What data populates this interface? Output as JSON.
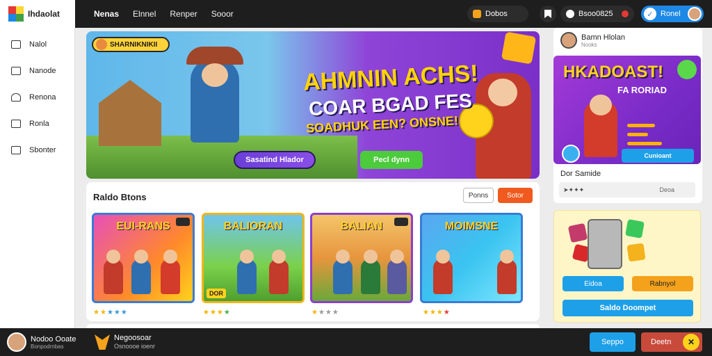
{
  "app": {
    "name": "Ihdaolat"
  },
  "nav": {
    "items": [
      "Nenas",
      "Elnnel",
      "Renper",
      "Sooor"
    ]
  },
  "header": {
    "coins_label": "Dobos",
    "time_label": "Bsoo0825",
    "user_label": "Ronel"
  },
  "sidebar": {
    "items": [
      {
        "label": "Nalol",
        "icon": "folder-icon"
      },
      {
        "label": "Nanode",
        "icon": "window-icon"
      },
      {
        "label": "Renona",
        "icon": "user-icon"
      },
      {
        "label": "Ronla",
        "icon": "list-icon"
      },
      {
        "label": "Sbonter",
        "icon": "chat-icon"
      }
    ]
  },
  "hero": {
    "badge": "SHARNIKNIKII",
    "line1": "AHMNIN ACHS!",
    "line2": "COAR BGAD FES",
    "line3": "SOADHUK EEN? ONSNE!",
    "button_primary": "Sasatind Hlador",
    "button_secondary": "Pecl dynn"
  },
  "games": {
    "title": "Raldo Btons",
    "btn_filter": "Ponns",
    "btn_sort": "Sotor",
    "cards": [
      {
        "title": "EUI-RANS",
        "badge": "",
        "rating": 4
      },
      {
        "title": "BALIORAN",
        "badge": "DOR",
        "rating": 4
      },
      {
        "title": "BALIAN",
        "badge": "",
        "rating": 1
      },
      {
        "title": "MOIMSNE",
        "badge": "",
        "rating": 3
      }
    ]
  },
  "right_panel": {
    "user_name": "Bamn Hlolan",
    "user_sub": "Nooks",
    "promo_title": "HKADOAST!",
    "promo_sub": "FA RORIAD",
    "promo_button": "Cunioant",
    "section_label": "Dor Samide",
    "row_value": "Deoa"
  },
  "rewards": {
    "button1": "Eidoa",
    "button2": "Rabnyol",
    "button3": "Saldo Doompet"
  },
  "footer": {
    "user_name": "Nodoo Ooate",
    "user_sub": "Bonpodrnbas",
    "title": "Negoosoar",
    "desc": "Osnoooe ioenr",
    "button1": "Seppo",
    "button2": "Deetn"
  }
}
